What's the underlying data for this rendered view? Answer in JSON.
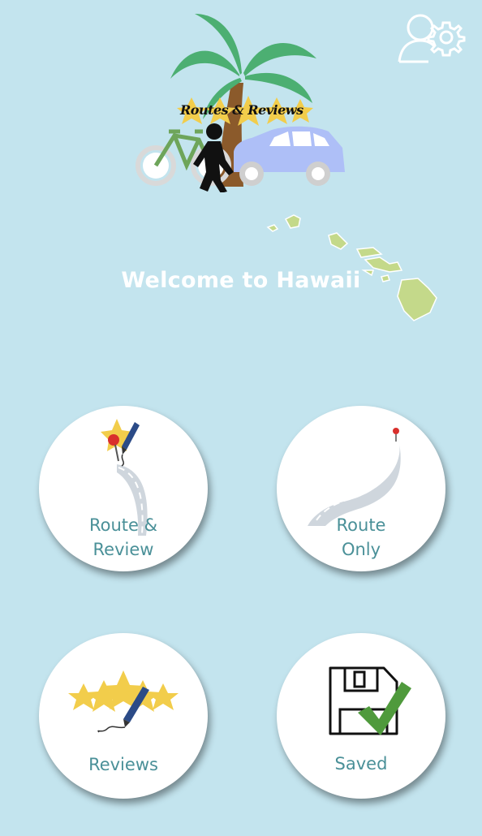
{
  "header": {
    "settings_icon": "user-settings-icon",
    "logo_text": "Routes & Reviews"
  },
  "hero": {
    "welcome_text": "Welcome to Hawaii"
  },
  "menu": {
    "route_review": {
      "label_line1": "Route &",
      "label_line2": "Review",
      "icon": "route-pin-pen-icon"
    },
    "route_only": {
      "label_line1": "Route",
      "label_line2": "Only",
      "icon": "road-pin-icon"
    },
    "reviews": {
      "label": "Reviews",
      "icon": "stars-pen-icon"
    },
    "saved": {
      "label": "Saved",
      "icon": "floppy-check-icon"
    }
  },
  "colors": {
    "background": "#c3e4ee",
    "label": "#4a9098",
    "welcome": "#ffffff"
  }
}
